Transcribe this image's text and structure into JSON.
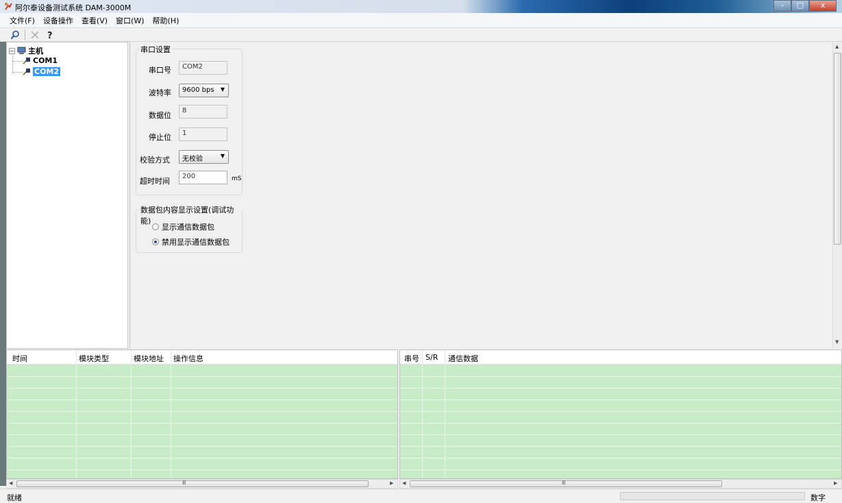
{
  "window": {
    "title": "阿尔泰设备测试系统 DAM-3000M",
    "minimize": "–",
    "maximize": "□",
    "close": "x"
  },
  "menu": [
    "文件(F)",
    "设备操作",
    "查看(V)",
    "窗口(W)",
    "帮助(H)"
  ],
  "toolbar": {
    "items": [
      "search-icon",
      "delete-icon",
      "help-icon"
    ]
  },
  "tree": {
    "root": "主机",
    "children": [
      "COM1",
      "COM2"
    ],
    "selected": "COM2"
  },
  "serial_settings": {
    "group_title": "串口设置",
    "port_label": "串口号",
    "port_value": "COM2",
    "baud_label": "波特率",
    "baud_value": "9600 bps",
    "databits_label": "数据位",
    "databits_value": "8",
    "stopbits_label": "停止位",
    "stopbits_value": "1",
    "parity_label": "校验方式",
    "parity_value": "无校验",
    "timeout_label": "超时时间",
    "timeout_value": "200",
    "timeout_unit": "mS"
  },
  "packet_display": {
    "group_title": "数据包内容显示设置(调试功能)",
    "option_show": "显示通信数据包",
    "option_disable": "禁用显示通信数据包",
    "selected": "option_disable"
  },
  "log_left": {
    "columns": [
      "时间",
      "模块类型",
      "模块地址",
      "操作信息"
    ]
  },
  "log_right": {
    "columns": [
      "串号",
      "S/R",
      "通信数据"
    ]
  },
  "status": {
    "text": "就绪",
    "indicator": "数字"
  },
  "colors": {
    "log_bg": "#c8ecc8",
    "selection": "#3399ff"
  }
}
